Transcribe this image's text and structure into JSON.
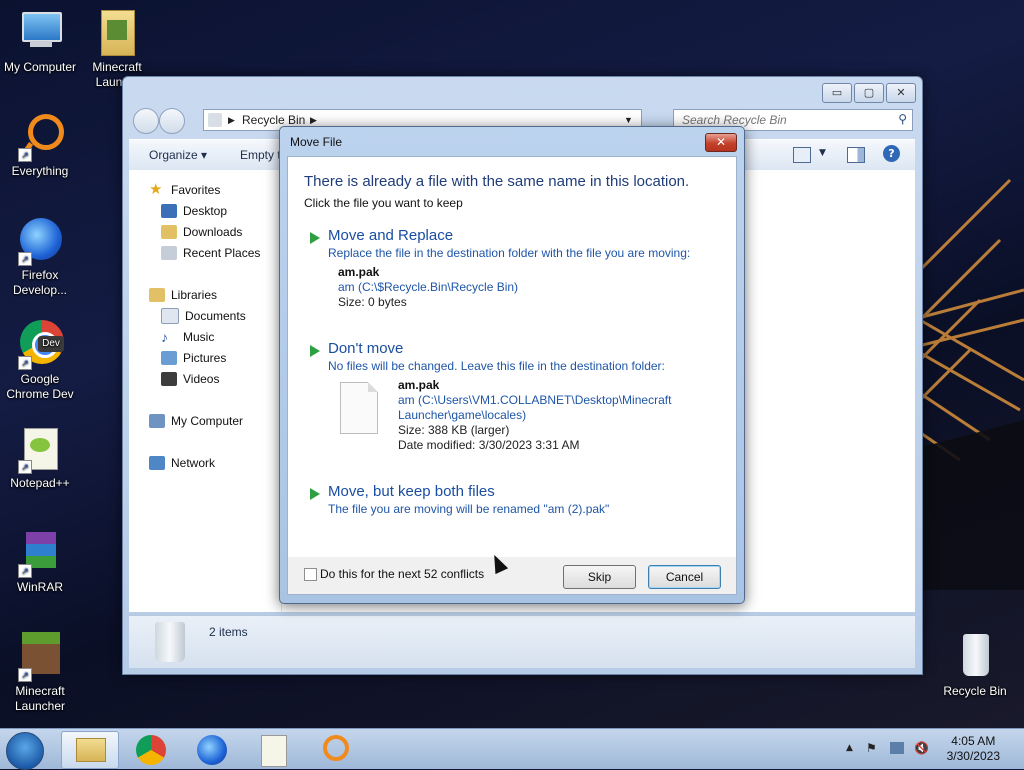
{
  "desktop": {
    "icons": [
      {
        "label": "My Computer"
      },
      {
        "label": "Minecraft Launc..."
      },
      {
        "label": "Everything"
      },
      {
        "label": "Firefox Develop..."
      },
      {
        "label": "Google Chrome Dev"
      },
      {
        "label": "Notepad++"
      },
      {
        "label": "WinRAR"
      },
      {
        "label": "Minecraft Launcher"
      },
      {
        "label": "Recycle Bin"
      }
    ]
  },
  "explorer": {
    "breadcrumb": "Recycle Bin",
    "search_placeholder": "Search Recycle Bin",
    "toolbar": {
      "organize": "Organize ▾",
      "empty": "Empty t"
    },
    "nav": {
      "favorites": "Favorites",
      "desktop": "Desktop",
      "downloads": "Downloads",
      "recent": "Recent Places",
      "libraries": "Libraries",
      "documents": "Documents",
      "music": "Music",
      "pictures": "Pictures",
      "videos": "Videos",
      "computer": "My Computer",
      "network": "Network"
    },
    "status": "2 items",
    "window_buttons": {
      "minimize": "▭",
      "maximize": "▢",
      "close": "✕"
    }
  },
  "dialog": {
    "title": "Move File",
    "close": "✕",
    "heading": "There is already a file with the same name in this location.",
    "subheading": "Click the file you want to keep",
    "replace": {
      "title": "Move and Replace",
      "desc": "Replace the file in the destination folder with the file you are moving:",
      "file_name": "am.pak",
      "file_location": "am (C:\\$Recycle.Bin\\Recycle Bin)",
      "file_size": "Size: 0 bytes"
    },
    "dont_move": {
      "title": "Don't move",
      "desc": "No files will be changed. Leave this file in the destination folder:",
      "file_name": "am.pak",
      "file_location_line1": "am (C:\\Users\\VM1.COLLABNET\\Desktop\\Minecraft",
      "file_location_line2": "Launcher\\game\\locales)",
      "file_size": "Size: 388 KB (larger)",
      "file_modified": "Date modified: 3/30/2023 3:31 AM"
    },
    "keep_both": {
      "title": "Move, but keep both files",
      "desc": "The file you are moving will be renamed \"am (2).pak\""
    },
    "checkbox_label": "Do this for the next 52 conflicts",
    "skip": "Skip",
    "cancel": "Cancel"
  },
  "taskbar": {
    "time": "4:05 AM",
    "date": "3/30/2023",
    "tray_expand": "▲"
  }
}
